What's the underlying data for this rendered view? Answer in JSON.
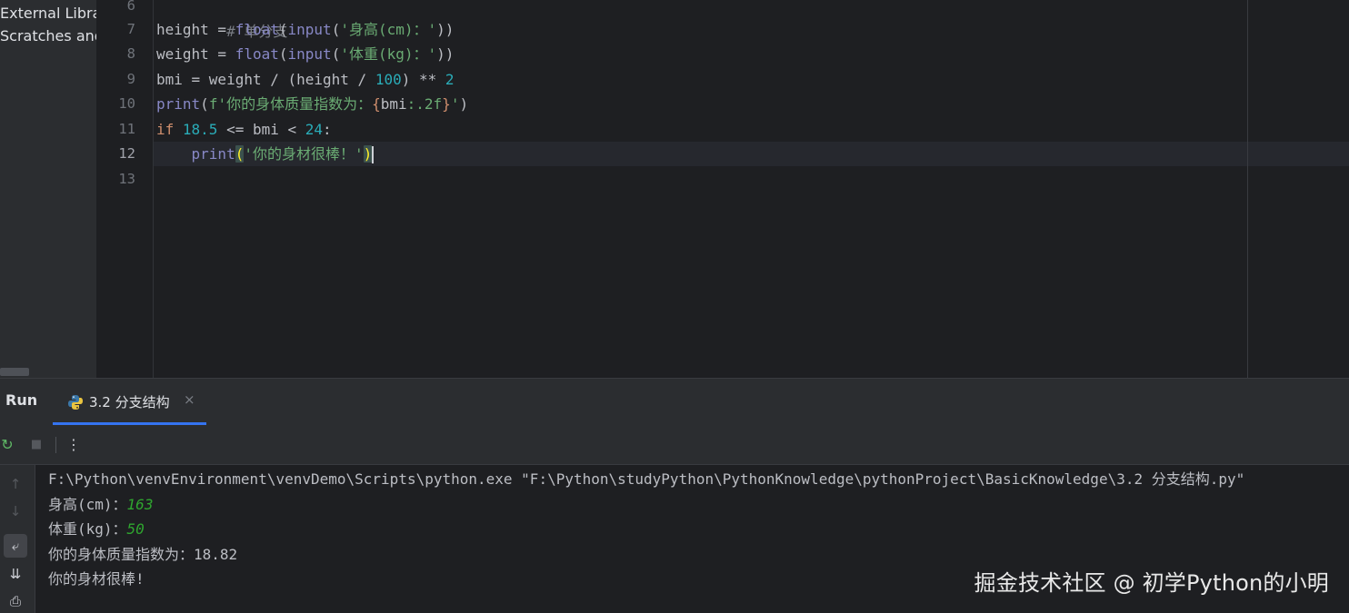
{
  "project_tree": {
    "items": [
      "External Librar",
      "Scratches and"
    ]
  },
  "editor": {
    "lines": [
      {
        "num": "6"
      },
      {
        "num": "7"
      },
      {
        "num": "8"
      },
      {
        "num": "9"
      },
      {
        "num": "10"
      },
      {
        "num": "11"
      },
      {
        "num": "12"
      },
      {
        "num": "13"
      }
    ],
    "code": {
      "l6_comment": "# 单分支",
      "l7_var": "height",
      "l7_eq": " = ",
      "l7_float": "float",
      "l7_open": "(",
      "l7_input": "input",
      "l7_open2": "(",
      "l7_str": "'身高(cm)：'",
      "l7_close": "))",
      "l8_var": "weight",
      "l8_eq": " = ",
      "l8_float": "float",
      "l8_open": "(",
      "l8_input": "input",
      "l8_open2": "(",
      "l8_str": "'体重(kg)：'",
      "l8_close": "))",
      "l9_a": "bmi = weight / (height / ",
      "l9_num1": "100",
      "l9_b": ") ** ",
      "l9_num2": "2",
      "l10_print": "print",
      "l10_open": "(",
      "l10_str1": "f'你的身体质量指数为：",
      "l10_brace_o": "{",
      "l10_expr": "bmi",
      "l10_fmt": ":.2f",
      "l10_brace_c": "}",
      "l10_str2": "'",
      "l10_close": ")",
      "l11_if": "if",
      "l11_sp": " ",
      "l11_num1": "18.5",
      "l11_mid": " <= bmi < ",
      "l11_num2": "24",
      "l11_colon": ":",
      "l12_indent": "    ",
      "l12_print": "print",
      "l12_open": "(",
      "l12_str": "'你的身材很棒！'",
      "l12_close": ")"
    }
  },
  "run": {
    "title": "Run",
    "tab_label": "3.2 分支结构",
    "tab_close": "×",
    "toolbar": {
      "rerun_icon": "↻",
      "stop_icon": "■",
      "more_icon": "⋮"
    },
    "side": {
      "up": "↑",
      "down": "↓",
      "wrap": "⤶",
      "scroll_end": "⇊",
      "print": "⎙"
    },
    "console": {
      "cmd": "F:\\Python\\venvEnvironment\\venvDemo\\Scripts\\python.exe \"F:\\Python\\studyPython\\PythonKnowledge\\pythonProject\\BasicKnowledge\\3.2 分支结构.py\"",
      "prompt1": "身高(cm)：",
      "input1": "163",
      "prompt2": "体重(kg)：",
      "input2": "50",
      "out1": "你的身体质量指数为：18.82",
      "out2": "你的身材很棒!"
    }
  },
  "watermark": "掘金技术社区 @ 初学Python的小明"
}
